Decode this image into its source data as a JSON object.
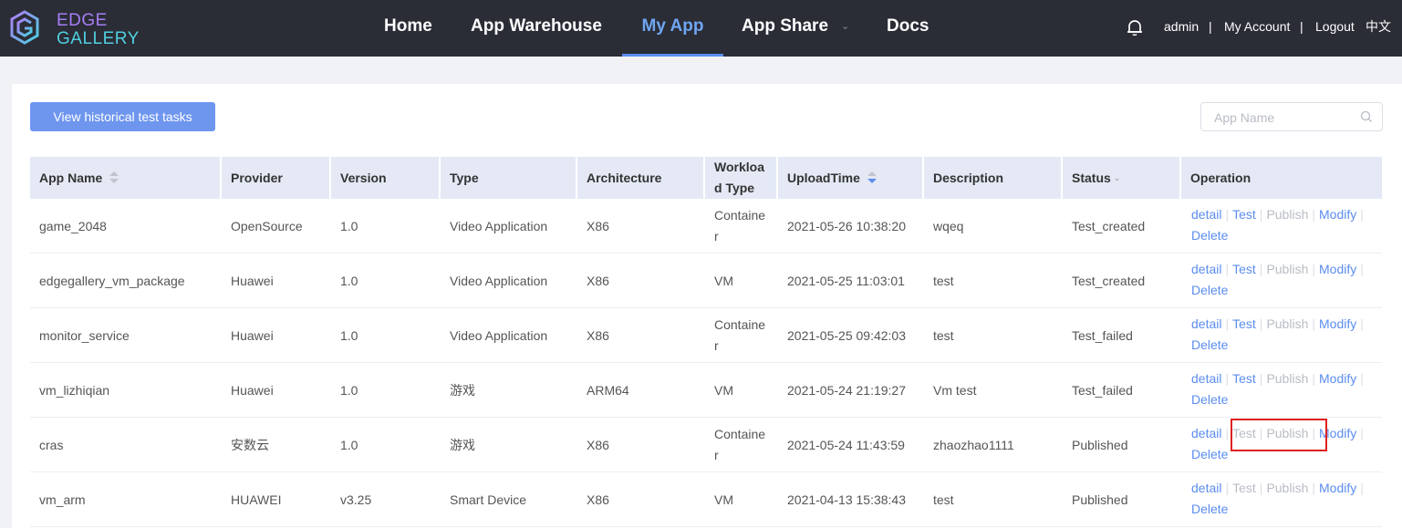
{
  "brand": {
    "line1": "EDGE",
    "line2": "GALLERY"
  },
  "nav": [
    "Home",
    "App Warehouse",
    "My App",
    "App Share",
    "Docs"
  ],
  "user": {
    "name": "admin",
    "account": "My Account",
    "logout": "Logout",
    "lang": "中文",
    "separator": "|"
  },
  "toolbar": {
    "history_button": "View historical test tasks",
    "search_placeholder": "App Name"
  },
  "table": {
    "headers": {
      "app_name": "App Name",
      "provider": "Provider",
      "version": "Version",
      "type": "Type",
      "architecture": "Architecture",
      "workload_line1": "Workloa",
      "workload_line2": "d Type",
      "upload_time": "UploadTime",
      "description": "Description",
      "status": "Status",
      "operation": "Operation"
    },
    "ops": {
      "detail": "detail",
      "test": "Test",
      "publish": "Publish",
      "modify": "Modify",
      "delete": "Delete",
      "sep": "|"
    },
    "rows": [
      {
        "name": "game_2048",
        "provider": "OpenSource",
        "version": "1.0",
        "type": "Video Application",
        "arch": "X86",
        "workload_a": "Containe",
        "workload_b": "r",
        "time": "2021-05-26 10:38:20",
        "desc": "wqeq",
        "status": "Test_created"
      },
      {
        "name": "edgegallery_vm_package",
        "provider": "Huawei",
        "version": "1.0",
        "type": "Video Application",
        "arch": "X86",
        "workload_a": "VM",
        "workload_b": "",
        "time": "2021-05-25 11:03:01",
        "desc": "test",
        "status": "Test_created"
      },
      {
        "name": "monitor_service",
        "provider": "Huawei",
        "version": "1.0",
        "type": "Video Application",
        "arch": "X86",
        "workload_a": "Containe",
        "workload_b": "r",
        "time": "2021-05-25 09:42:03",
        "desc": "test",
        "status": "Test_failed"
      },
      {
        "name": "vm_lizhiqian",
        "provider": "Huawei",
        "version": "1.0",
        "type": "游戏",
        "arch": "ARM64",
        "workload_a": "VM",
        "workload_b": "",
        "time": "2021-05-24 21:19:27",
        "desc": "Vm test",
        "status": "Test_failed"
      },
      {
        "name": "cras",
        "provider": "安数云",
        "version": "1.0",
        "type": "游戏",
        "arch": "X86",
        "workload_a": "Containe",
        "workload_b": "r",
        "time": "2021-05-24 11:43:59",
        "desc": "zhaozhao1111",
        "status": "Published"
      },
      {
        "name": "vm_arm",
        "provider": "HUAWEI",
        "version": "v3.25",
        "type": "Smart Device",
        "arch": "X86",
        "workload_a": "VM",
        "workload_b": "",
        "time": "2021-04-13 15:38:43",
        "desc": "test",
        "status": "Published"
      }
    ]
  }
}
